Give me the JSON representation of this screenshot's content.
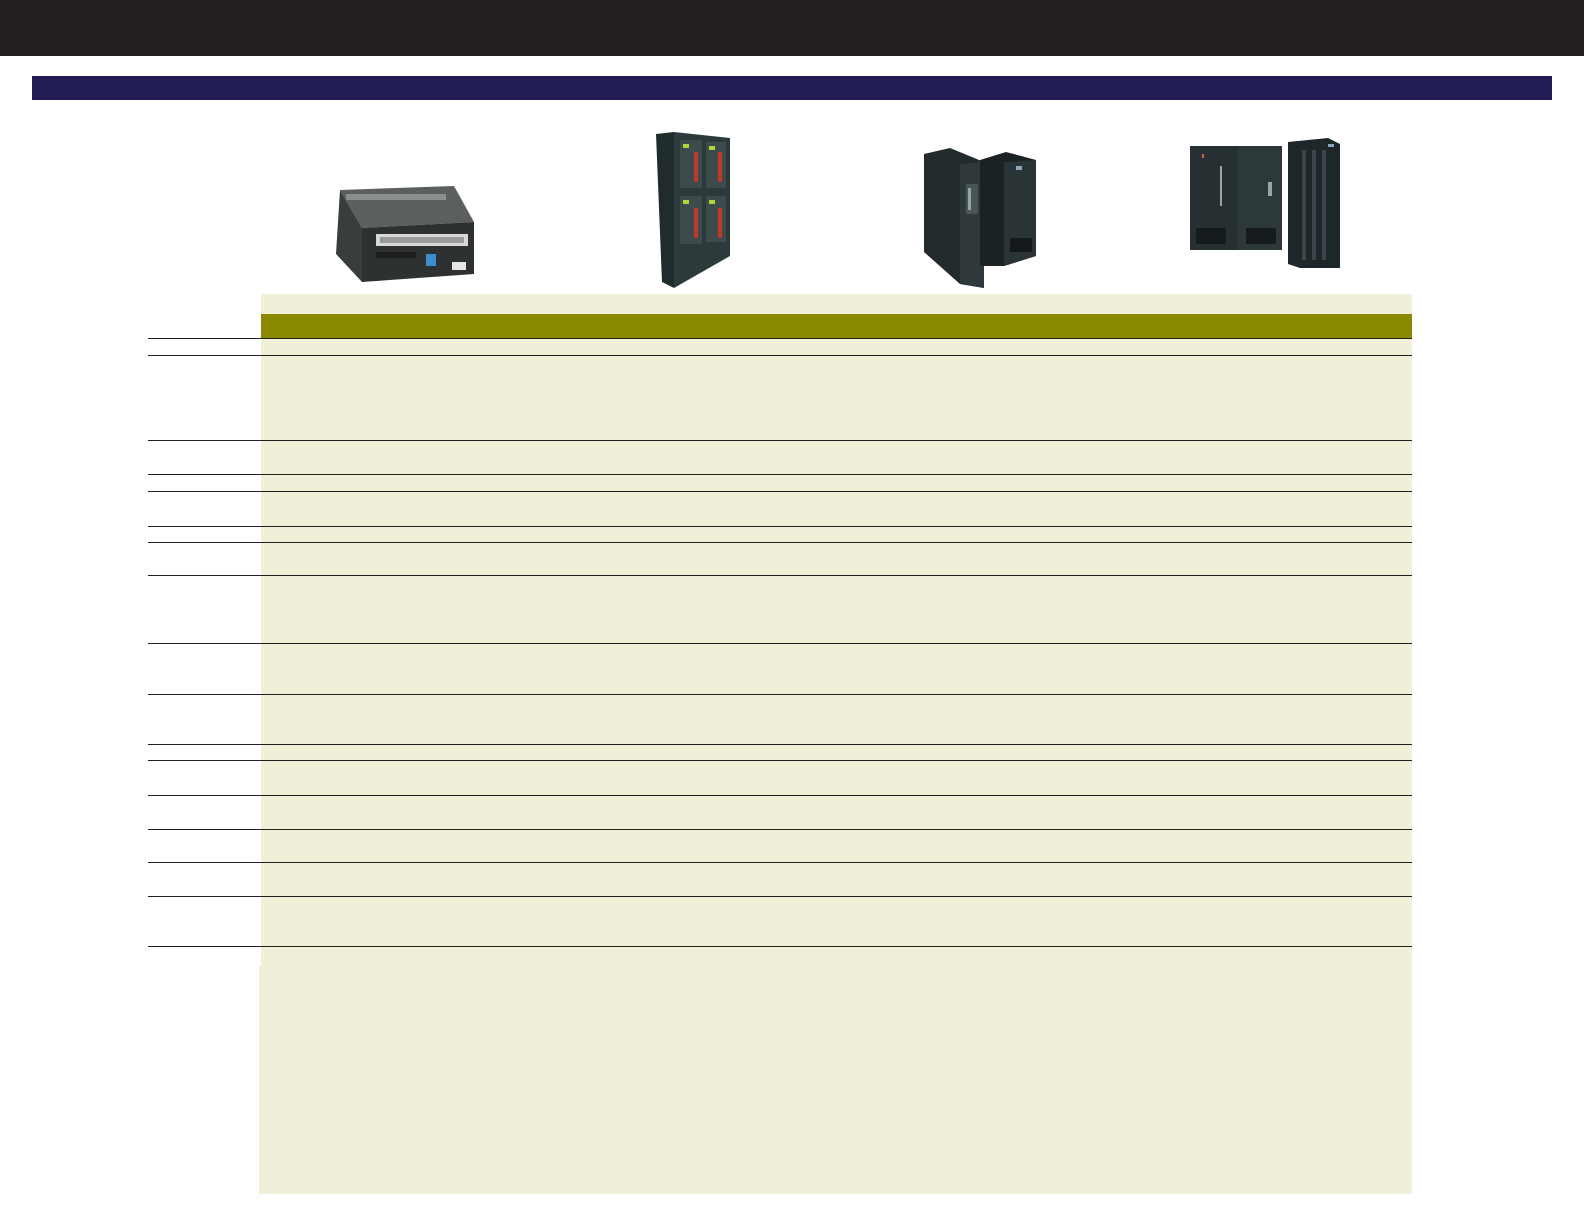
{
  "header": {
    "title": ""
  },
  "section": {
    "title": ""
  },
  "products": [
    {
      "icon": "tape-drive-icon"
    },
    {
      "icon": "tower-library-icon"
    },
    {
      "icon": "frame-library-icon"
    },
    {
      "icon": "large-library-icon"
    }
  ],
  "table": {
    "header_label": ""
  },
  "colors": {
    "top_bar": "#231f20",
    "title_bar": "#221c55",
    "table_header": "#8a8900",
    "table_background": "#f0efd8"
  }
}
